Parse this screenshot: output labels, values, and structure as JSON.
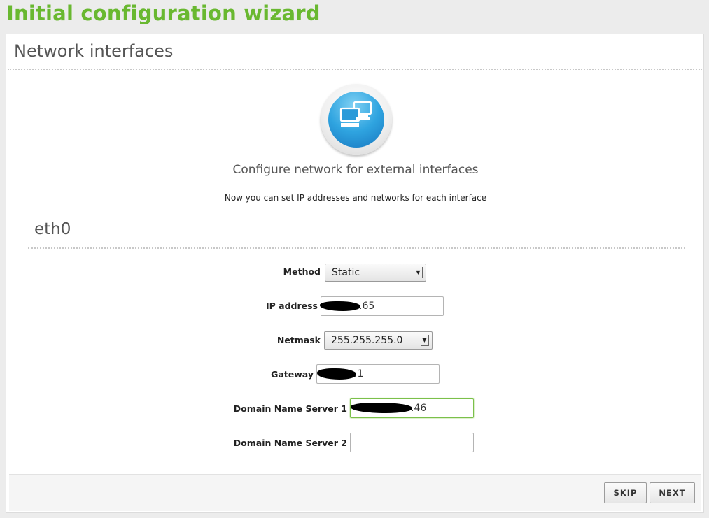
{
  "app": {
    "title": "Initial configuration wizard"
  },
  "panel": {
    "title": "Network interfaces",
    "icon": "network-computers-icon",
    "subtitle": "Configure network for external interfaces",
    "description": "Now you can set IP addresses and networks for each interface"
  },
  "interface": {
    "name": "eth0",
    "fields": {
      "method": {
        "label": "Method",
        "value": "Static"
      },
      "ip_address": {
        "label": "IP address",
        "value_visible": ".65"
      },
      "netmask": {
        "label": "Netmask",
        "value": "255.255.255.0"
      },
      "gateway": {
        "label": "Gateway",
        "value_visible": ".1"
      },
      "dns1": {
        "label": "Domain Name Server 1",
        "value_visible": ".46"
      },
      "dns2": {
        "label": "Domain Name Server 2",
        "value": ""
      }
    }
  },
  "footer": {
    "skip_label": "SKIP",
    "next_label": "NEXT"
  },
  "colors": {
    "title_green": "#69b830",
    "focus_green": "#7bc04a",
    "icon_blue": "#2fa4e0"
  }
}
